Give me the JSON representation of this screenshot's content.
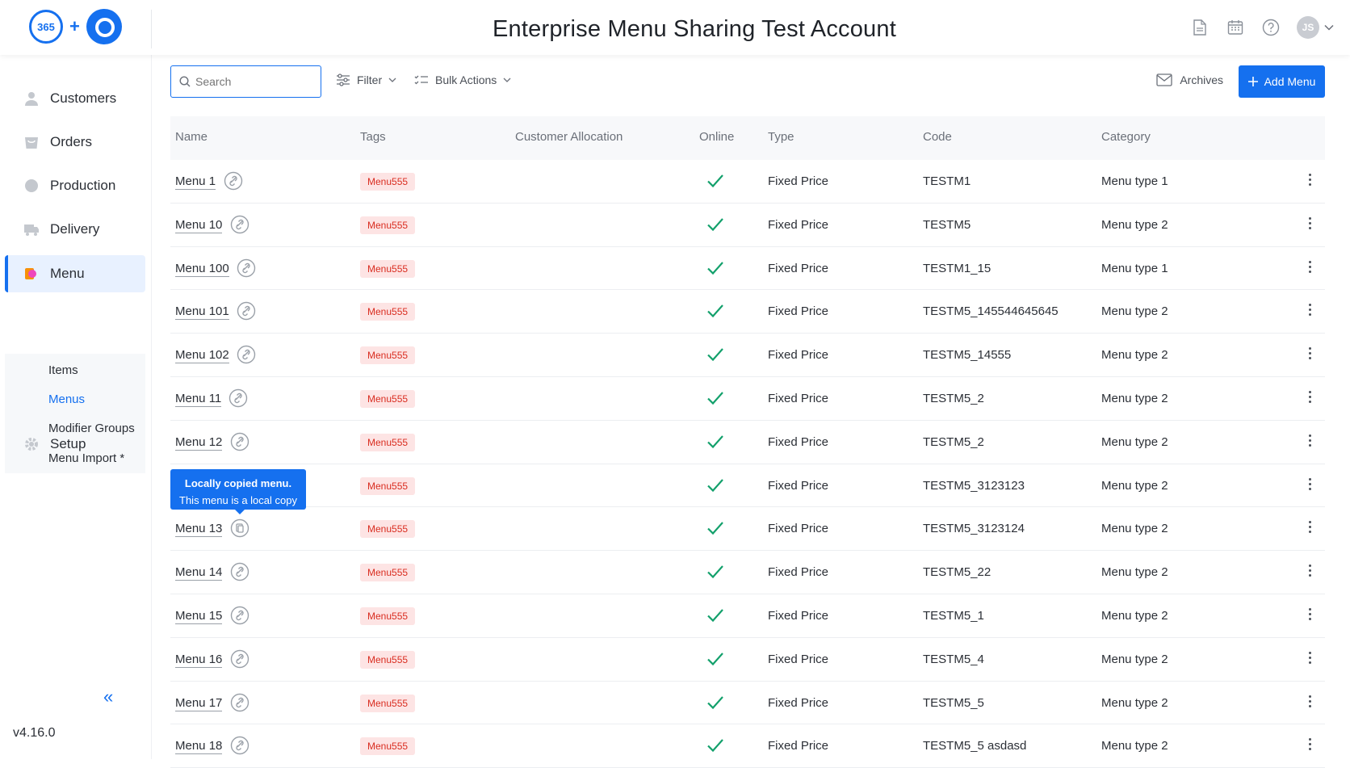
{
  "header": {
    "title": "Enterprise Menu Sharing Test Account",
    "logo_text": "365",
    "avatar_initials": "JS"
  },
  "sidebar": {
    "items": [
      {
        "label": "Customers",
        "icon": "customers-icon"
      },
      {
        "label": "Orders",
        "icon": "orders-icon"
      },
      {
        "label": "Production",
        "icon": "production-icon"
      },
      {
        "label": "Delivery",
        "icon": "delivery-icon"
      },
      {
        "label": "Menu",
        "icon": "menu-icon",
        "active": true
      },
      {
        "label": "Setup",
        "icon": "setup-icon"
      }
    ],
    "submenu": [
      {
        "label": "Items"
      },
      {
        "label": "Menus",
        "active": true
      },
      {
        "label": "Modifier Groups"
      },
      {
        "label": "Menu Import *"
      }
    ],
    "collapse_glyph": "«",
    "version": "v4.16.0"
  },
  "toolbar": {
    "search_placeholder": "Search",
    "filter_label": "Filter",
    "bulk_label": "Bulk Actions",
    "archives_label": "Archives",
    "add_label": "Add Menu"
  },
  "table": {
    "columns": [
      "Name",
      "Tags",
      "Customer Allocation",
      "Online",
      "Type",
      "Code",
      "Category"
    ],
    "rows": [
      {
        "name": "Menu 1",
        "tag": "Menu555",
        "online": true,
        "type": "Fixed Price",
        "code": "TESTM1",
        "category": "Menu type 1"
      },
      {
        "name": "Menu 10",
        "tag": "Menu555",
        "online": true,
        "type": "Fixed Price",
        "code": "TESTM5",
        "category": "Menu type 2"
      },
      {
        "name": "Menu 100",
        "tag": "Menu555",
        "online": true,
        "type": "Fixed Price",
        "code": "TESTM1_15",
        "category": "Menu type 1"
      },
      {
        "name": "Menu 101",
        "tag": "Menu555",
        "online": true,
        "type": "Fixed Price",
        "code": "TESTM5_145544645645",
        "category": "Menu type 2"
      },
      {
        "name": "Menu 102",
        "tag": "Menu555",
        "online": true,
        "type": "Fixed Price",
        "code": "TESTM5_14555",
        "category": "Menu type 2"
      },
      {
        "name": "Menu 11",
        "tag": "Menu555",
        "online": true,
        "type": "Fixed Price",
        "code": "TESTM5_2",
        "category": "Menu type 2"
      },
      {
        "name": "Menu 12",
        "tag": "Menu555",
        "online": true,
        "type": "Fixed Price",
        "code": "TESTM5_2",
        "category": "Menu type 2"
      },
      {
        "name": "",
        "tag": "Menu555",
        "online": true,
        "type": "Fixed Price",
        "code": "TESTM5_3123123",
        "category": "Menu type 2"
      },
      {
        "name": "Menu 13",
        "tag": "Menu555",
        "online": true,
        "type": "Fixed Price",
        "code": "TESTM5_3123124",
        "category": "Menu type 2"
      },
      {
        "name": "Menu 14",
        "tag": "Menu555",
        "online": true,
        "type": "Fixed Price",
        "code": "TESTM5_22",
        "category": "Menu type 2"
      },
      {
        "name": "Menu 15",
        "tag": "Menu555",
        "online": true,
        "type": "Fixed Price",
        "code": "TESTM5_1",
        "category": "Menu type 2"
      },
      {
        "name": "Menu 16",
        "tag": "Menu555",
        "online": true,
        "type": "Fixed Price",
        "code": "TESTM5_4",
        "category": "Menu type 2"
      },
      {
        "name": "Menu 17",
        "tag": "Menu555",
        "online": true,
        "type": "Fixed Price",
        "code": "TESTM5_5",
        "category": "Menu type 2"
      },
      {
        "name": "Menu 18",
        "tag": "Menu555",
        "online": true,
        "type": "Fixed Price",
        "code": "TESTM5_5 asdasd",
        "category": "Menu type 2"
      }
    ]
  },
  "tooltip": {
    "line1": "Locally copied menu.",
    "line2": "This menu is a local copy"
  },
  "colors": {
    "accent": "#1570ef",
    "tag_bg": "#fde4e4",
    "tag_text": "#d92d20",
    "check": "#12a06b"
  }
}
